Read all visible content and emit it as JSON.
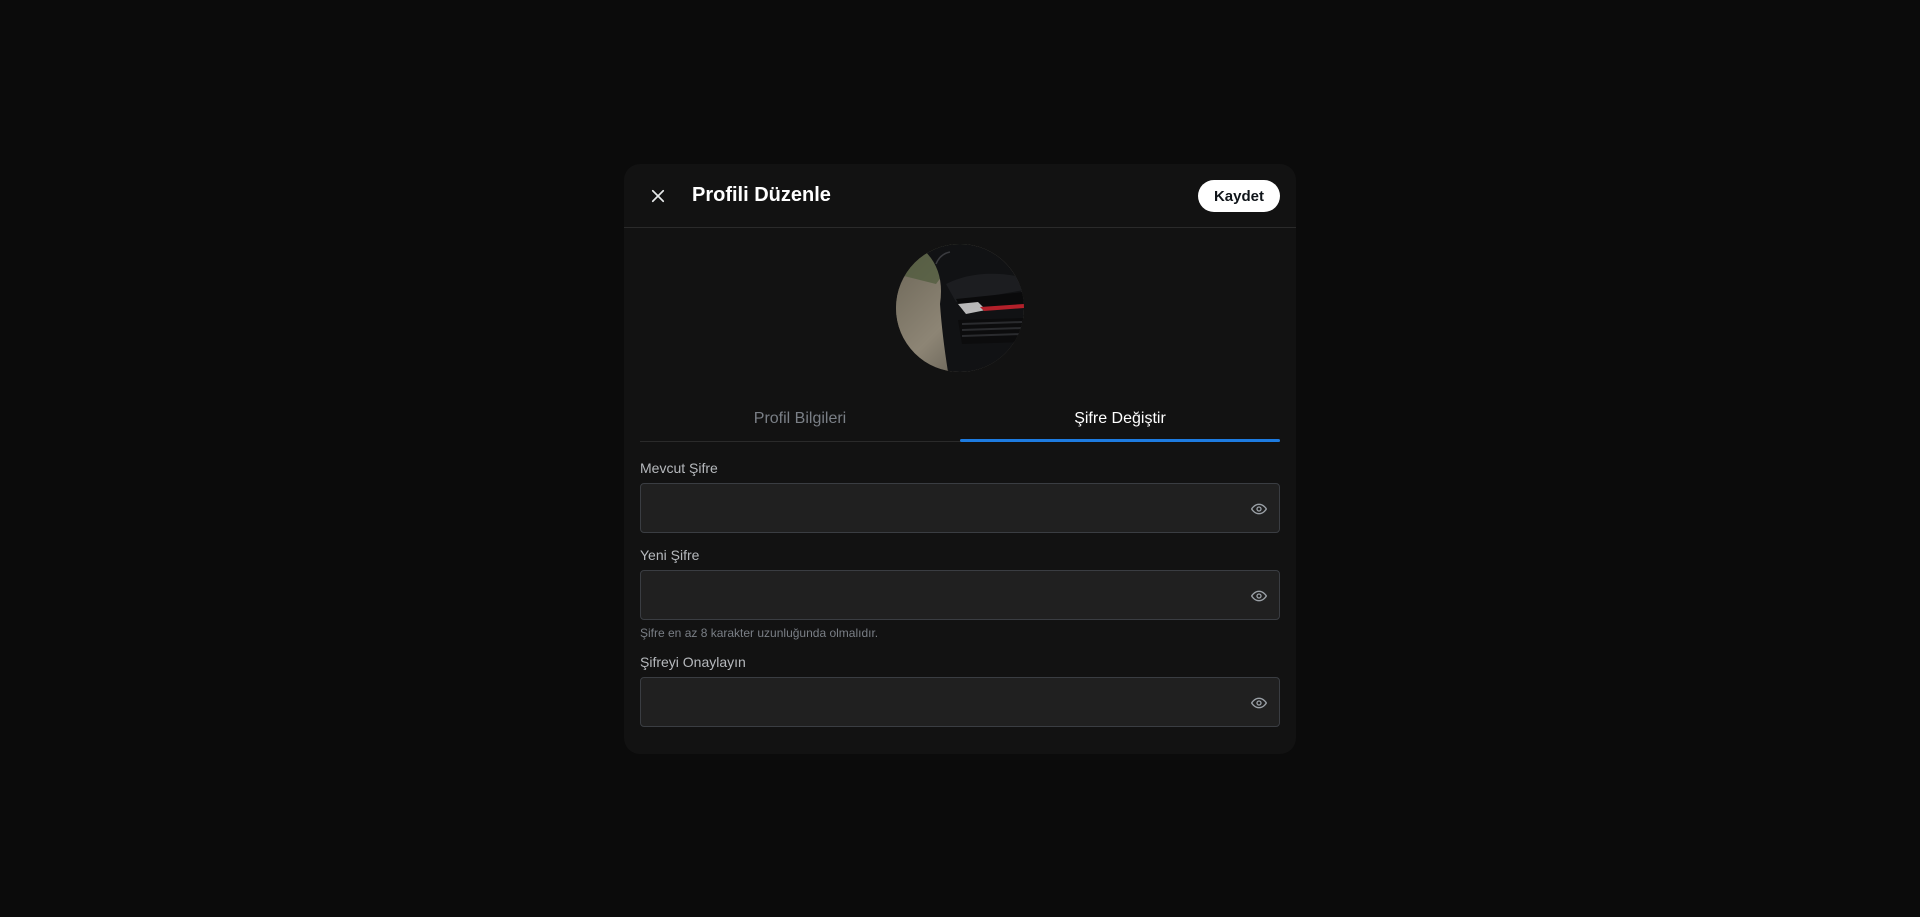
{
  "modal": {
    "title": "Profili Düzenle",
    "save_label": "Kaydet",
    "close_icon": "close-icon"
  },
  "avatar": {
    "alt": "Profil fotoğrafı"
  },
  "tabs": [
    {
      "label": "Profil Bilgileri",
      "active": false
    },
    {
      "label": "Şifre Değiştir",
      "active": true
    }
  ],
  "form": {
    "current_password": {
      "label": "Mevcut Şifre",
      "value": "",
      "placeholder": ""
    },
    "new_password": {
      "label": "Yeni Şifre",
      "value": "",
      "placeholder": "",
      "hint": "Şifre en az 8 karakter uzunluğunda olmalıdır."
    },
    "confirm_password": {
      "label": "Şifreyi Onaylayın",
      "value": "",
      "placeholder": ""
    }
  },
  "colors": {
    "accent": "#1d7be0",
    "background": "#0b0b0b",
    "modal": "#121212",
    "input": "#202020"
  }
}
